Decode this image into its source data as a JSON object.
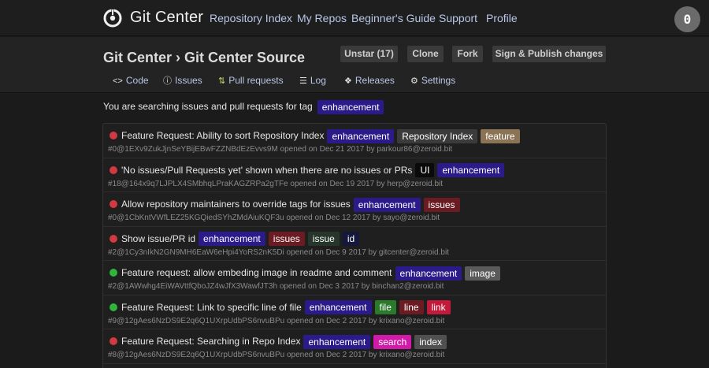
{
  "topbar": {
    "brand": "Git Center",
    "nav": [
      "Repository Index",
      "My Repos",
      "Beginner's Guide",
      "Support",
      "Profile"
    ],
    "avatar": "0"
  },
  "repo": {
    "title": "Git Center › Git Center Source",
    "buttons": [
      "Unstar (17)",
      "Clone",
      "Fork",
      "Sign & Publish changes"
    ],
    "tabs": [
      "Code",
      "Issues",
      "Pull requests",
      "Log",
      "Releases",
      "Settings"
    ]
  },
  "search": {
    "text": "You are searching issues and pull requests for tag",
    "tag": "enhancement"
  },
  "colors": {
    "enhancement": "#2b1a8a",
    "repo_index": "#3b3b3b",
    "feature": "#8a7455",
    "ui": "#0a0a0a",
    "issues": "#6b1b22",
    "issue": "#26362a",
    "id": "#15183a",
    "image": "#5a5a5a",
    "file": "#2b7a2b",
    "line": "#6b1b22",
    "link": "#c21a3a",
    "search": "#d01aa8",
    "index": "#505050",
    "open": "#d03a40",
    "closed": "#2fb53a"
  },
  "issues": [
    {
      "state": "open",
      "title": "Feature Request: Ability to sort Repository Index",
      "tags": [
        "enhancement",
        "Repository Index",
        "feature"
      ],
      "meta": "#0@1EXv9ZukJjnSeYBijEBwFZZNBdEzEvvs9M opened on Dec 21 2017 by parkour86@zeroid.bit"
    },
    {
      "state": "open",
      "title": "'No issues/Pull Requests yet' shown when there are no issues or PRs",
      "tags": [
        "UI",
        "enhancement"
      ],
      "meta": "#18@164x9q7LJPLX4SMbhqLPraKAGZRPa2gTFe opened on Dec 19 2017 by herp@zeroid.bit"
    },
    {
      "state": "open",
      "title": "Allow repository maintainers to override tags for issues",
      "tags": [
        "enhancement",
        "issues"
      ],
      "meta": "#0@1CbKntVWfLEZ25KGQiedSYhZMdAiuKQF3u opened on Dec 12 2017 by sayo@zeroid.bit"
    },
    {
      "state": "open",
      "title": "Show issue/PR id",
      "tags": [
        "enhancement",
        "issues",
        "issue",
        "id"
      ],
      "meta": "#2@1Cy3nIkN2GN9MH6EaW6eHpi4YoRS2nK5Di opened on Dec 9 2017 by gitcenter@zeroid.bit"
    },
    {
      "state": "closed",
      "title": "Feature request: allow embeding image in readme and comment",
      "tags": [
        "enhancement",
        "image"
      ],
      "meta": "#2@1AWwhg4EiWAVttfQboJZ4wJfX3WawfJT3h opened on Dec 3 2017 by binchan2@zeroid.bit"
    },
    {
      "state": "closed",
      "title": "Feature Request: Link to specific line of file",
      "tags": [
        "enhancement",
        "file",
        "line",
        "link"
      ],
      "meta": "#9@12gAes6NzDS9E2q6Q1UXrpUdbPS6nvuBPu opened on Dec 2 2017 by krixano@zeroid.bit"
    },
    {
      "state": "open",
      "title": "Feature Request: Searching in Repo Index",
      "tags": [
        "enhancement",
        "search",
        "index"
      ],
      "meta": "#8@12gAes6NzDS9E2q6Q1UXrpUdbPS6nvuBPu opened on Dec 2 2017 by krixano@zeroid.bit"
    }
  ]
}
